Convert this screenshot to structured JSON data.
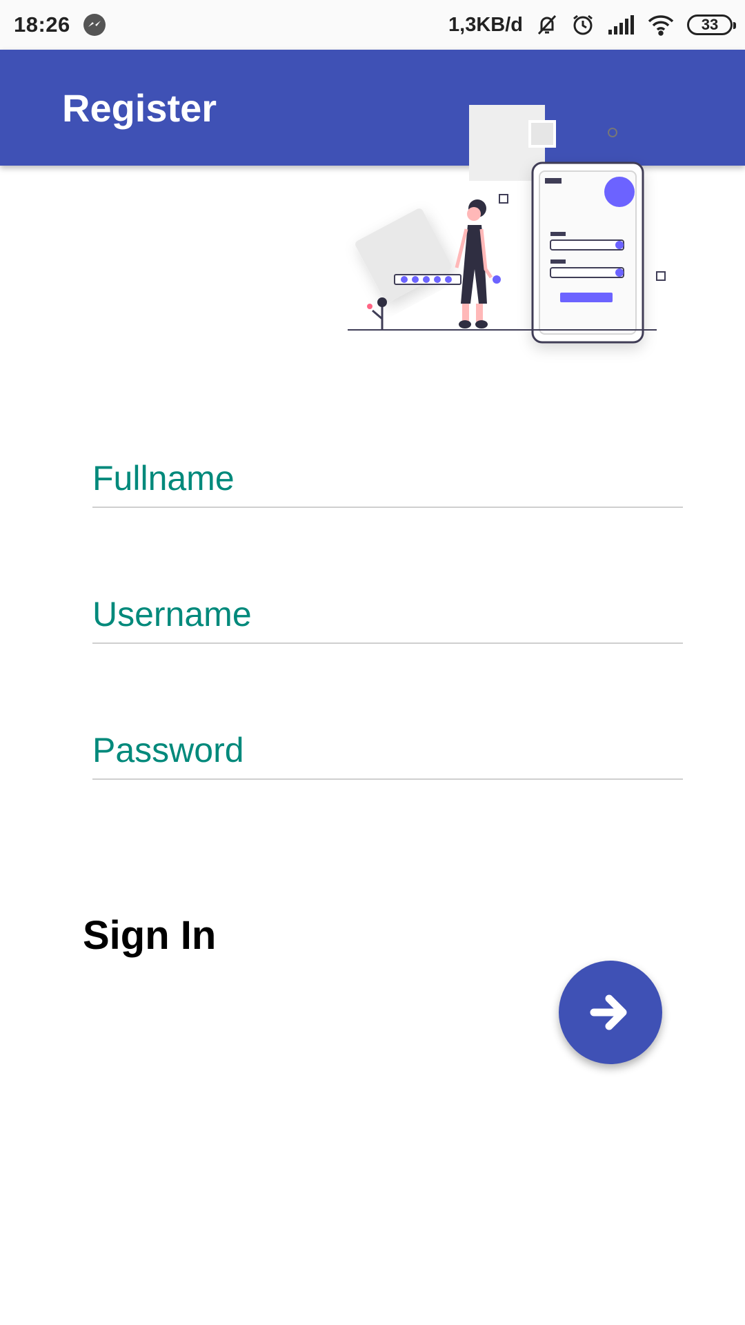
{
  "status_bar": {
    "time": "18:26",
    "net_speed": "1,3KB/d",
    "battery": "33",
    "icons": [
      "messenger-icon",
      "bell-muted-icon",
      "alarm-icon",
      "signal-icon",
      "wifi-icon",
      "battery-icon"
    ]
  },
  "app_bar": {
    "title": "Register",
    "color": "#3f51b5"
  },
  "illustration": {
    "icon": "register-illustration",
    "accent": "#6c63ff"
  },
  "form": {
    "fullname": {
      "placeholder": "Fullname",
      "value": ""
    },
    "username": {
      "placeholder": "Username",
      "value": ""
    },
    "password": {
      "placeholder": "Password",
      "value": ""
    },
    "hint_color": "#00897b"
  },
  "signin": {
    "label": "Sign In",
    "fab_icon": "arrow-right-icon"
  }
}
